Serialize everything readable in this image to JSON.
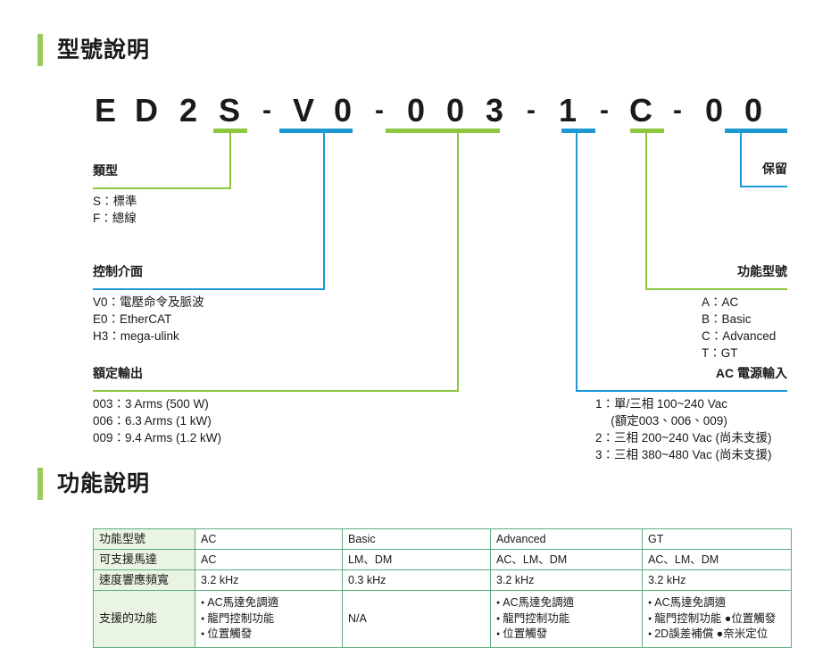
{
  "sections": {
    "model": {
      "title": "型號說明"
    },
    "function": {
      "title": "功能說明"
    }
  },
  "model_code": {
    "segments": [
      {
        "chars": [
          "E"
        ],
        "marker": "none"
      },
      {
        "chars": [
          "D"
        ],
        "marker": "none"
      },
      {
        "chars": [
          "2"
        ],
        "marker": "none"
      },
      {
        "chars": [
          "S"
        ],
        "marker": "green"
      },
      {
        "chars": [
          "-"
        ],
        "marker": "none"
      },
      {
        "chars": [
          "V",
          "0"
        ],
        "marker": "blue"
      },
      {
        "chars": [
          "-"
        ],
        "marker": "none"
      },
      {
        "chars": [
          "0",
          "0",
          "3"
        ],
        "marker": "green"
      },
      {
        "chars": [
          "-"
        ],
        "marker": "none"
      },
      {
        "chars": [
          "1"
        ],
        "marker": "blue"
      },
      {
        "chars": [
          "-"
        ],
        "marker": "none"
      },
      {
        "chars": [
          "C"
        ],
        "marker": "green"
      },
      {
        "chars": [
          "-"
        ],
        "marker": "none"
      },
      {
        "chars": [
          "0",
          "0"
        ],
        "marker": "blue"
      }
    ],
    "chars": {
      "c0": "E",
      "c1": "D",
      "c2": "2",
      "c3": "S",
      "d0": "-",
      "c4": "V",
      "c5": "0",
      "d1": "-",
      "c6": "0",
      "c7": "0",
      "c8": "3",
      "d2": "-",
      "c9": "1",
      "d3": "-",
      "c10": "C",
      "d4": "-",
      "c11": "0",
      "c12": "0"
    }
  },
  "callouts": {
    "type": {
      "title": "類型",
      "items": [
        "S：標準",
        "F：總線"
      ]
    },
    "control_interface": {
      "title": "控制介面",
      "items": [
        "V0：電壓命令及脈波",
        "E0：EtherCAT",
        "H3：mega-ulink"
      ]
    },
    "rated_output": {
      "title": "額定輸出",
      "items": [
        "003：3 Arms (500 W)",
        "006：6.3 Arms (1 kW)",
        "009：9.4 Arms (1.2 kW)"
      ]
    },
    "reserved": {
      "title": "保留",
      "items": []
    },
    "function_model": {
      "title": "功能型號",
      "items": [
        "A：AC",
        "B：Basic",
        "C：Advanced",
        "T：GT"
      ]
    },
    "ac_power_input": {
      "title": "AC 電源輸入",
      "items": [
        "1：單/三相 100~240 Vac",
        "　 (額定003、006、009)",
        "2：三相 200~240 Vac (尚未支援)",
        "3：三相 380~480 Vac (尚未支援)"
      ]
    }
  },
  "function_table": {
    "rows": [
      {
        "header": "功能型號",
        "cells": [
          "AC",
          "Basic",
          "Advanced",
          "GT"
        ]
      },
      {
        "header": "可支援馬達",
        "cells": [
          "AC",
          "LM、DM",
          "AC、LM、DM",
          "AC、LM、DM"
        ]
      },
      {
        "header": "速度響應頻寬",
        "cells": [
          "3.2 kHz",
          "0.3 kHz",
          "3.2 kHz",
          "3.2 kHz"
        ]
      }
    ],
    "features_row": {
      "header": "支援的功能",
      "columns": [
        {
          "type": "list",
          "items": [
            "AC馬達免調適",
            "龍門控制功能",
            "位置觸發"
          ]
        },
        {
          "type": "text",
          "text": "N/A"
        },
        {
          "type": "list",
          "items": [
            "AC馬達免調適",
            "龍門控制功能",
            "位置觸發"
          ]
        },
        {
          "type": "list",
          "items": [
            "AC馬達免調適",
            "龍門控制功能 ●位置觸發",
            "2D誤差補償 ●奈米定位"
          ]
        }
      ]
    }
  },
  "colors": {
    "green": "#8DC63F",
    "blue": "#1B9AD6",
    "heading_accent": "#9ACA5C",
    "table_border": "#5FAE7E",
    "table_rowhead_bg": "#EAF4E2"
  }
}
